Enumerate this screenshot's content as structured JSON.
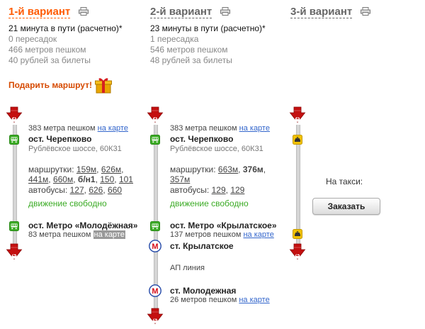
{
  "variants": [
    {
      "title": "1-й вариант",
      "time": "21 минута в пути (расчетно)*",
      "transfers": "0 пересадок",
      "walk": "466 метров пешком",
      "cost": "40 рублей за билеты"
    },
    {
      "title": "2-й вариант",
      "time": "23 минуты в пути (расчетно)*",
      "transfers": "1 пересадка",
      "walk": "546 метров пешком",
      "cost": "48 рублей за билеты"
    },
    {
      "title": "3-й вариант"
    }
  ],
  "gift": {
    "label": "Подарить маршрут!"
  },
  "map_link": "на карте",
  "route1": {
    "start_walk": "383 метра пешком",
    "stop1": "ост. Черепково",
    "road": "Рублёвское шоссе, 60К31",
    "minibus_prefix": "маршрутки:",
    "minibus": [
      "159м",
      "626м",
      "441м",
      "660м",
      "б/н1",
      "150",
      "101"
    ],
    "bus_prefix": "автобусы:",
    "bus": [
      "127",
      "626",
      "660"
    ],
    "traffic": "движение свободно",
    "stop2": "ост. Метро «Молодёжная»",
    "end_walk": "83 метра пешком"
  },
  "route2": {
    "start_walk": "383 метра пешком",
    "stop1": "ост. Черепково",
    "road": "Рублёвское шоссе, 60К31",
    "minibus_prefix": "маршрутки:",
    "minibus": [
      "663м",
      "376м",
      "357м"
    ],
    "bus_prefix": "автобусы:",
    "bus": [
      "129",
      "129"
    ],
    "traffic": "движение свободно",
    "stop2": "ост. Метро «Крылатское»",
    "walk2": "137 метров пешком",
    "metro1": "ст. Крылатское",
    "line": "АП линия",
    "metro2": "ст. Молодежная",
    "end_walk": "26 метров пешком"
  },
  "route3": {
    "taxi_label": "На такси:",
    "order_button": "Заказать"
  },
  "markers": {
    "start": "1",
    "end": "2"
  },
  "colors": {
    "accent": "#ff5a00",
    "link": "#3366cc",
    "bus": "#3bab25",
    "taxi": "#f2c200",
    "metro": "#d6101a",
    "arrow": "#c41010"
  }
}
